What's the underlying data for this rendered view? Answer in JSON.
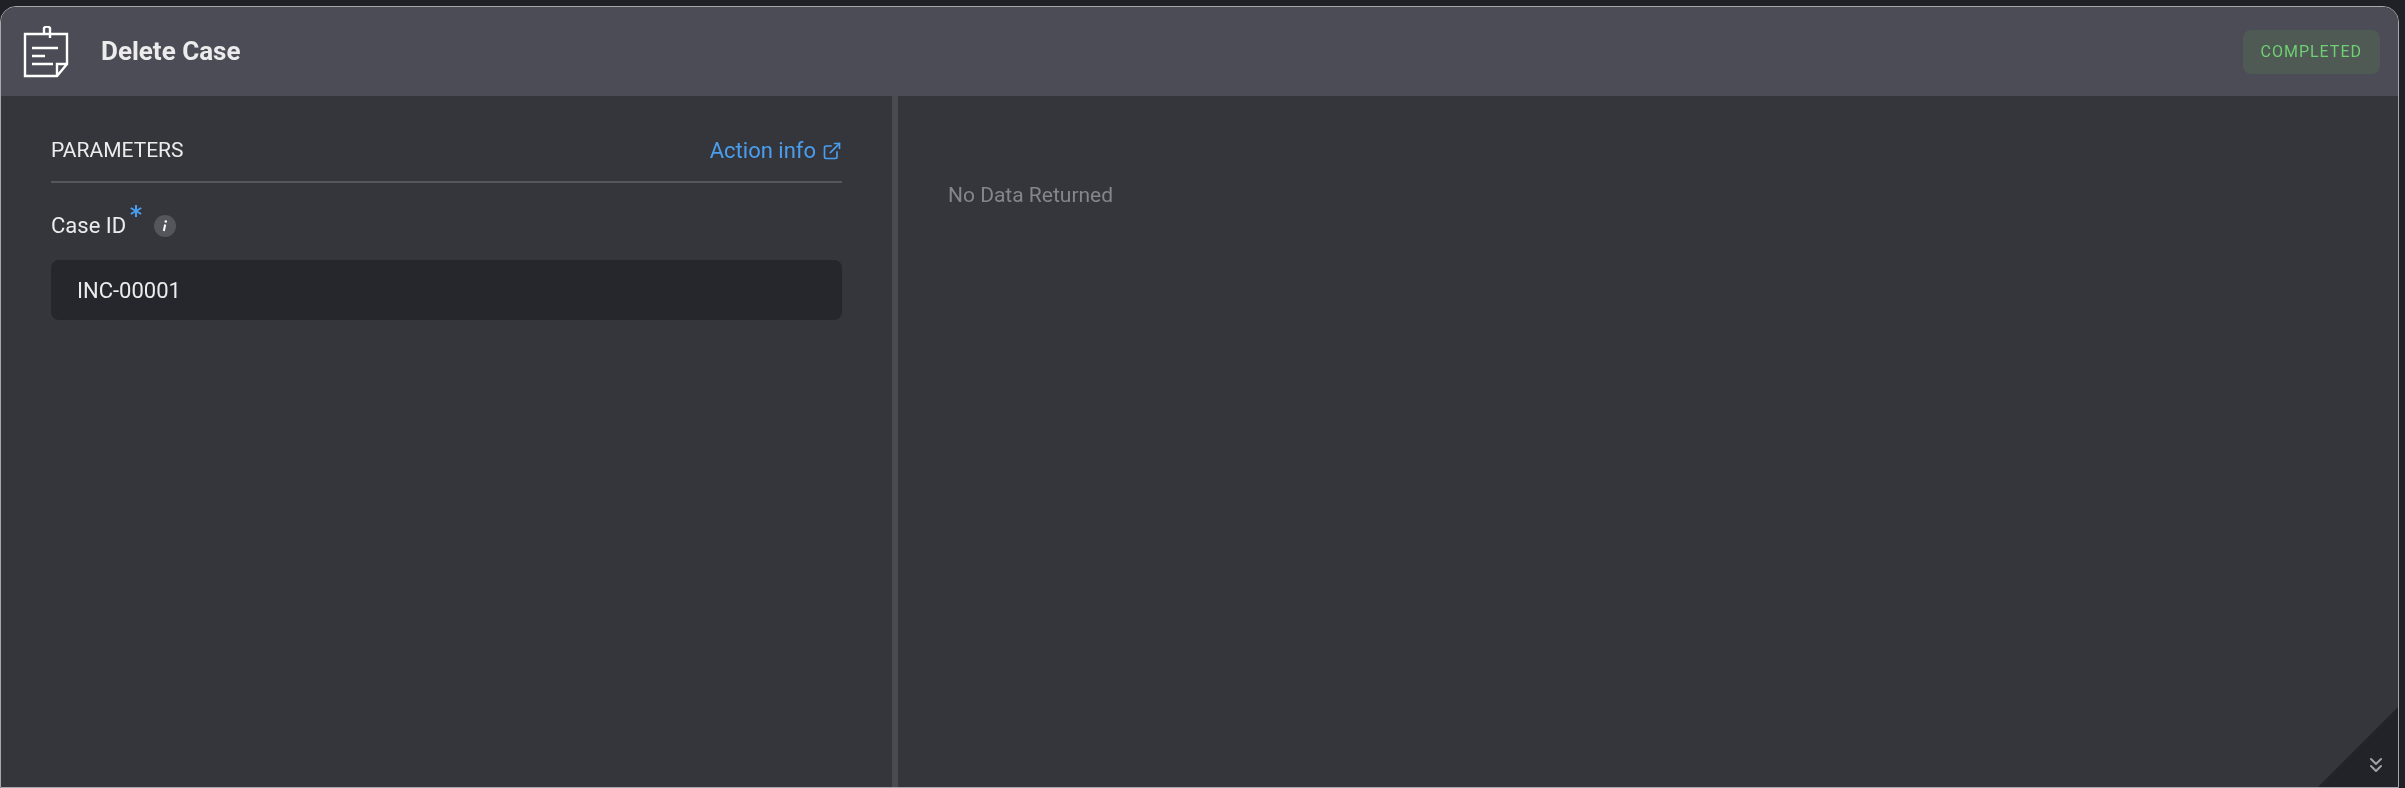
{
  "header": {
    "title": "Delete Case",
    "status": {
      "label": "COMPLETED",
      "kind": "success"
    }
  },
  "parameters": {
    "heading": "PARAMETERS",
    "link": "Action info",
    "fields": [
      {
        "label": "Case ID",
        "required": true,
        "value": "INC-00001"
      }
    ]
  },
  "result": {
    "message": "No Data Returned"
  }
}
